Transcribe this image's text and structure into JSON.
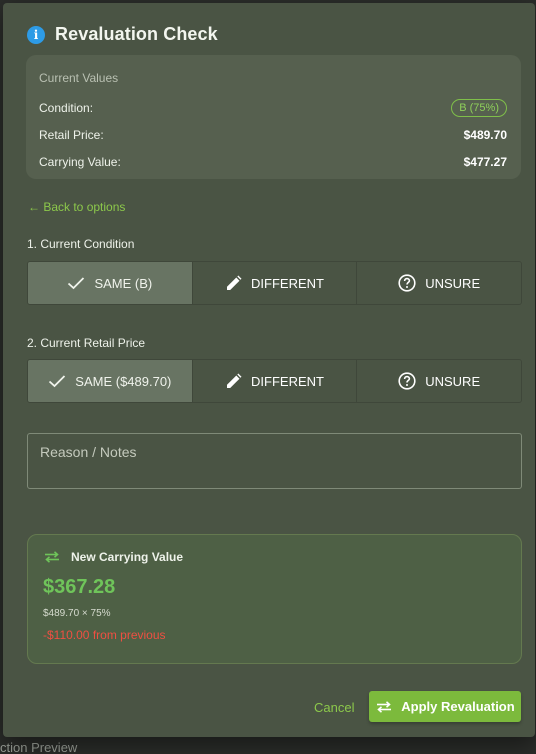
{
  "dialog": {
    "title": "Revaluation Check",
    "title_icon": "info-icon"
  },
  "current_values": {
    "header": "Current Values",
    "condition_label": "Condition:",
    "condition_value": "B (75%)",
    "retail_label": "Retail Price:",
    "retail_value": "$489.70",
    "carrying_label": "Carrying Value:",
    "carrying_value": "$477.27"
  },
  "back_link": "← Back to options",
  "condition_section": {
    "label": "1. Current Condition",
    "options": [
      {
        "label": "SAME (B)",
        "icon": "check-icon",
        "selected": true
      },
      {
        "label": "DIFFERENT",
        "icon": "pencil-icon",
        "selected": false
      },
      {
        "label": "UNSURE",
        "icon": "help-circle-icon",
        "selected": false
      }
    ]
  },
  "price_section": {
    "label": "2. Current Retail Price",
    "options": [
      {
        "label": "SAME ($489.70)",
        "icon": "check-icon",
        "selected": true
      },
      {
        "label": "DIFFERENT",
        "icon": "pencil-icon",
        "selected": false
      },
      {
        "label": "UNSURE",
        "icon": "help-circle-icon",
        "selected": false
      }
    ]
  },
  "notes": {
    "placeholder": "Reason / Notes",
    "value": ""
  },
  "new_carrying_value": {
    "title": "New Carrying Value",
    "icon": "swap-arrows-icon",
    "amount": "$367.28",
    "formula": "$489.70 × 75%",
    "difference": "-$110.00 from previous"
  },
  "actions": {
    "cancel_label": "Cancel",
    "apply_label": "Apply Revaluation"
  },
  "background": {
    "footer_fragment": "ction Preview"
  },
  "colors": {
    "accent": "#7cba3c",
    "link": "#8cc84b",
    "negative": "#ef4f42",
    "positive": "#6fc45a",
    "info": "#2d9be6"
  }
}
